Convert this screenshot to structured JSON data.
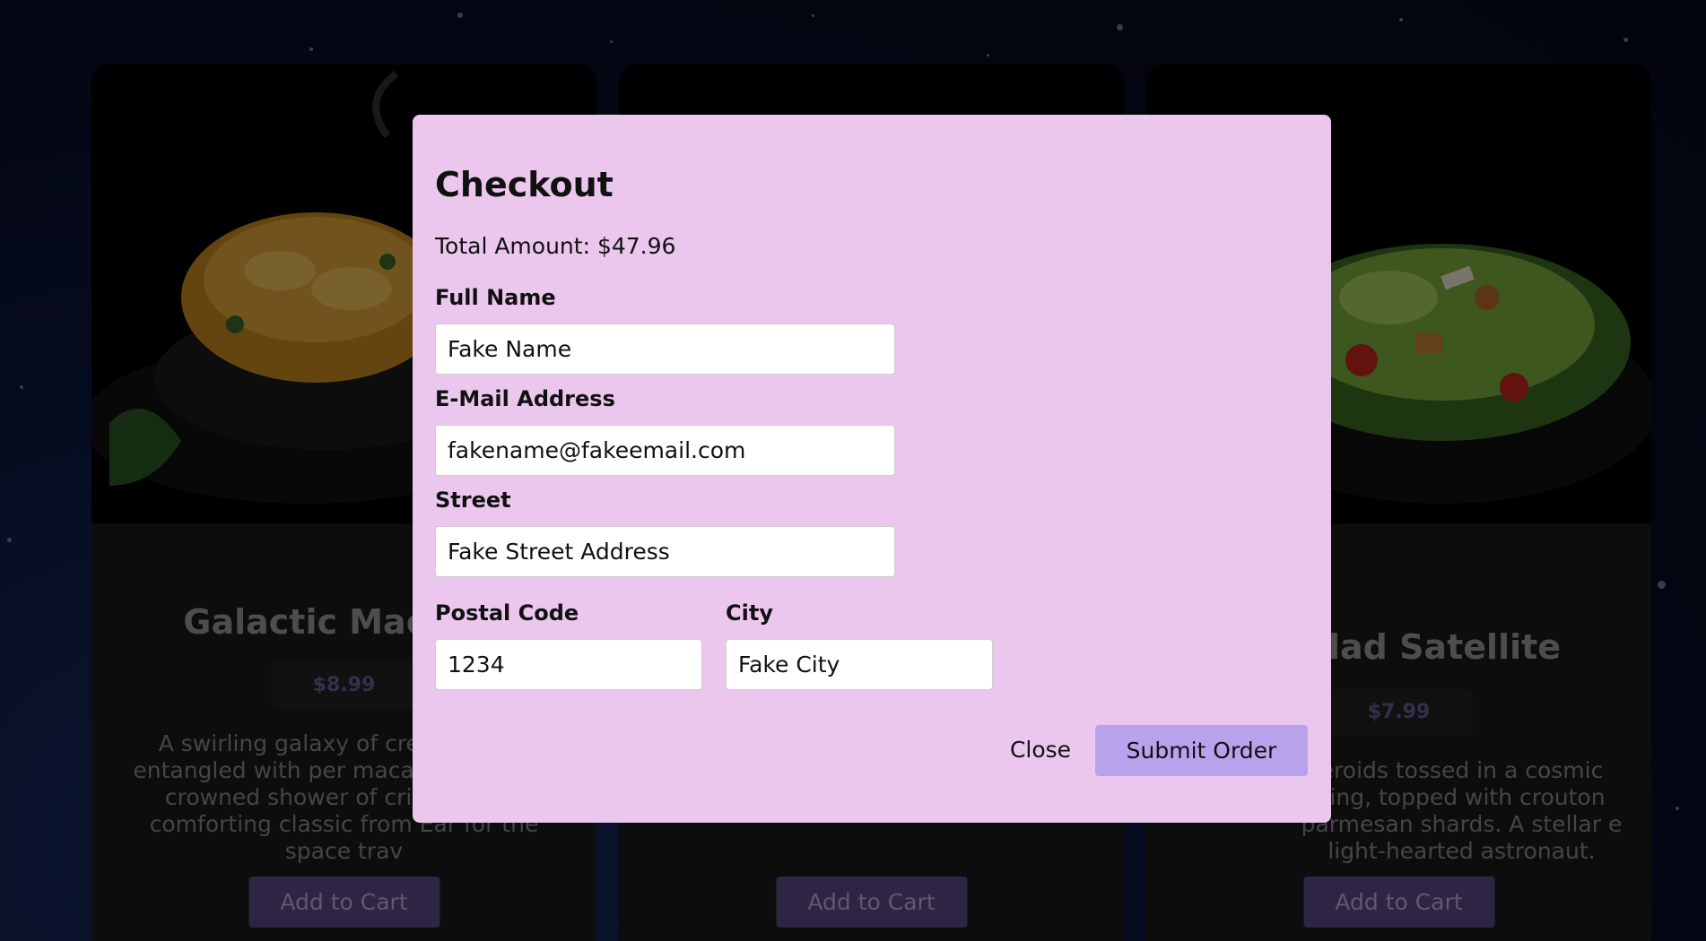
{
  "products": [
    {
      "title": "Galactic Mac & C",
      "price": "$8.99",
      "description": "A swirling galaxy of crear cheese entangled with per macaroni strands, crowned shower of crispy bread comforting classic from Ear for the space trav",
      "button_label": "Add to Cart"
    },
    {
      "title": "",
      "price": "",
      "description": "",
      "button_label": "Add to Cart"
    },
    {
      "title": "Salad Satellite",
      "price": "$7.99",
      "description": "eroids tossed in a cosmic sing, topped with crouton parmesan shards. A stellar e light-hearted astronaut.",
      "button_label": "Add to Cart"
    }
  ],
  "checkout": {
    "title": "Checkout",
    "total": "Total Amount: $47.96",
    "fields": {
      "full_name": {
        "label": "Full Name",
        "value": "Fake Name"
      },
      "email": {
        "label": "E-Mail Address",
        "value": "fakename@fakeemail.com"
      },
      "street": {
        "label": "Street",
        "value": "Fake Street Address"
      },
      "postal_code": {
        "label": "Postal Code",
        "value": "1234"
      },
      "city": {
        "label": "City",
        "value": "Fake City"
      }
    },
    "close_label": "Close",
    "submit_label": "Submit Order"
  },
  "colors": {
    "modal_bg": "#ebc7ee",
    "submit_bg": "#b9a2ec",
    "cart_button_bg": "#5a4a86",
    "price_text": "#6c5d98"
  }
}
